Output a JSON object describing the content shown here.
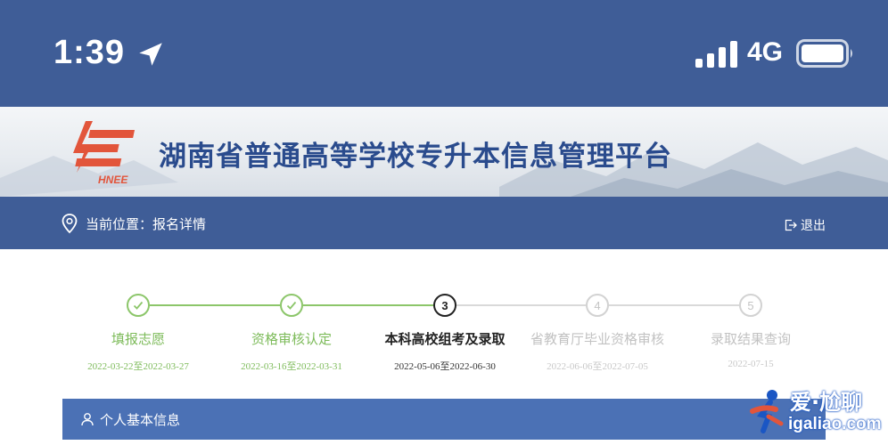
{
  "status_bar": {
    "time": "1:39",
    "network": "4G",
    "icons": [
      "location-arrow-icon",
      "signal-bars-icon",
      "battery-icon"
    ]
  },
  "header": {
    "logo_text": "HNEE",
    "title": "湖南省普通高等学校专升本信息管理平台"
  },
  "nav": {
    "breadcrumb": "当前位置：报名详情",
    "logout_label": "退出"
  },
  "steps": [
    {
      "number": "",
      "label": "填报志愿",
      "date": "2022-03-22至2022-03-27",
      "status": "done"
    },
    {
      "number": "",
      "label": "资格审核认定",
      "date": "2022-03-16至2022-03-31",
      "status": "done"
    },
    {
      "number": "3",
      "label": "本科高校组考及录取",
      "date": "2022-05-06至2022-06-30",
      "status": "current"
    },
    {
      "number": "4",
      "label": "省教育厅毕业资格审核",
      "date": "2022-06-06至2022-07-05",
      "status": "pending"
    },
    {
      "number": "5",
      "label": "录取结果查询",
      "date": "2022-07-15",
      "status": "pending"
    }
  ],
  "section": {
    "title": "个人基本信息"
  },
  "watermark": {
    "title": "爱·尬聊",
    "url": "igaliao.com"
  },
  "colors": {
    "primary": "#3f5d97",
    "done": "#8cc66a",
    "section": "#4b71b5",
    "title": "#2a4b8d"
  }
}
